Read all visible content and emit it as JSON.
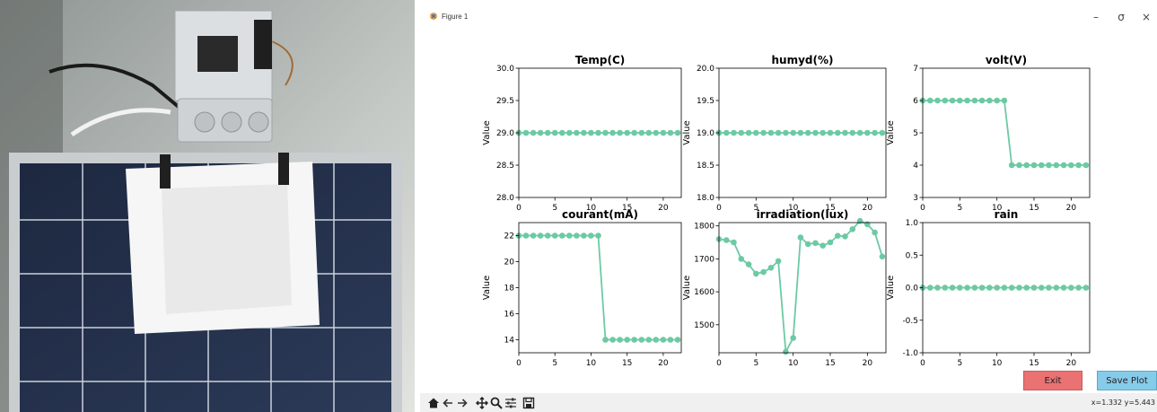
{
  "window": {
    "title": "Figure 1"
  },
  "window_controls": {
    "minimize": "–",
    "maximize": "σ",
    "close": "×"
  },
  "colors": {
    "series": "#6ccaa3",
    "exit": "#ea7272",
    "save": "#86cbe9",
    "toolbar": "#f0f0f0"
  },
  "chart_data": [
    {
      "type": "line",
      "title": "Temp(C)",
      "ylabel": "Value",
      "xlim": [
        0,
        22.5
      ],
      "ylim": [
        28.0,
        30.0
      ],
      "xticks": [
        0,
        5,
        10,
        15,
        20
      ],
      "yticks": [
        "28.0",
        "28.5",
        "29.0",
        "29.5",
        "30.0"
      ],
      "values": [
        29,
        29,
        29,
        29,
        29,
        29,
        29,
        29,
        29,
        29,
        29,
        29,
        29,
        29,
        29,
        29,
        29,
        29,
        29,
        29,
        29,
        29,
        29
      ]
    },
    {
      "type": "line",
      "title": "humyd(%)",
      "ylabel": "Value",
      "xlim": [
        0,
        22.5
      ],
      "ylim": [
        18.0,
        20.0
      ],
      "xticks": [
        0,
        5,
        10,
        15,
        20
      ],
      "yticks": [
        "18.0",
        "18.5",
        "19.0",
        "19.5",
        "20.0"
      ],
      "values": [
        19,
        19,
        19,
        19,
        19,
        19,
        19,
        19,
        19,
        19,
        19,
        19,
        19,
        19,
        19,
        19,
        19,
        19,
        19,
        19,
        19,
        19,
        19
      ]
    },
    {
      "type": "line",
      "title": "volt(V)",
      "ylabel": "Value",
      "xlim": [
        0,
        22.5
      ],
      "ylim": [
        3,
        7
      ],
      "xticks": [
        0,
        5,
        10,
        15,
        20
      ],
      "yticks": [
        "3",
        "4",
        "5",
        "6",
        "7"
      ],
      "values": [
        6,
        6,
        6,
        6,
        6,
        6,
        6,
        6,
        6,
        6,
        6,
        6,
        4,
        4,
        4,
        4,
        4,
        4,
        4,
        4,
        4,
        4,
        4
      ]
    },
    {
      "type": "line",
      "title": "courant(mA)",
      "ylabel": "Value",
      "xlim": [
        0,
        22.5
      ],
      "ylim": [
        13,
        23
      ],
      "xticks": [
        0,
        5,
        10,
        15,
        20
      ],
      "yticks": [
        "14",
        "16",
        "18",
        "20",
        "22"
      ],
      "values": [
        22,
        22,
        22,
        22,
        22,
        22,
        22,
        22,
        22,
        22,
        22,
        22,
        14,
        14,
        14,
        14,
        14,
        14,
        14,
        14,
        14,
        14,
        14
      ]
    },
    {
      "type": "line",
      "title": "irradiation(lux)",
      "ylabel": "Value",
      "xlim": [
        0,
        22.5
      ],
      "ylim": [
        1415,
        1810
      ],
      "xticks": [
        0,
        5,
        10,
        15,
        20
      ],
      "yticks": [
        "1500",
        "1600",
        "1700",
        "1800"
      ],
      "values": [
        1760,
        1757,
        1750,
        1700,
        1683,
        1655,
        1660,
        1673,
        1693,
        1418,
        1460,
        1765,
        1745,
        1748,
        1740,
        1750,
        1770,
        1768,
        1790,
        1815,
        1805,
        1780,
        1707
      ]
    },
    {
      "type": "line",
      "title": "rain",
      "ylabel": "Value",
      "xlim": [
        0,
        22.5
      ],
      "ylim": [
        -1.0,
        1.0
      ],
      "xticks": [
        0,
        5,
        10,
        15,
        20
      ],
      "yticks": [
        "-1.0",
        "-0.5",
        "0.0",
        "0.5",
        "1.0"
      ],
      "values": [
        0,
        0,
        0,
        0,
        0,
        0,
        0,
        0,
        0,
        0,
        0,
        0,
        0,
        0,
        0,
        0,
        0,
        0,
        0,
        0,
        0,
        0,
        0
      ]
    }
  ],
  "buttons": {
    "exit": "Exit",
    "save": "Save Plot"
  },
  "toolbar": {
    "tools": [
      "home-icon",
      "back-arrow-icon",
      "forward-arrow-icon",
      "pan-icon",
      "zoom-icon",
      "configure-subplots-icon",
      "save-icon"
    ],
    "coords": "x=1.332 y=5.443"
  }
}
